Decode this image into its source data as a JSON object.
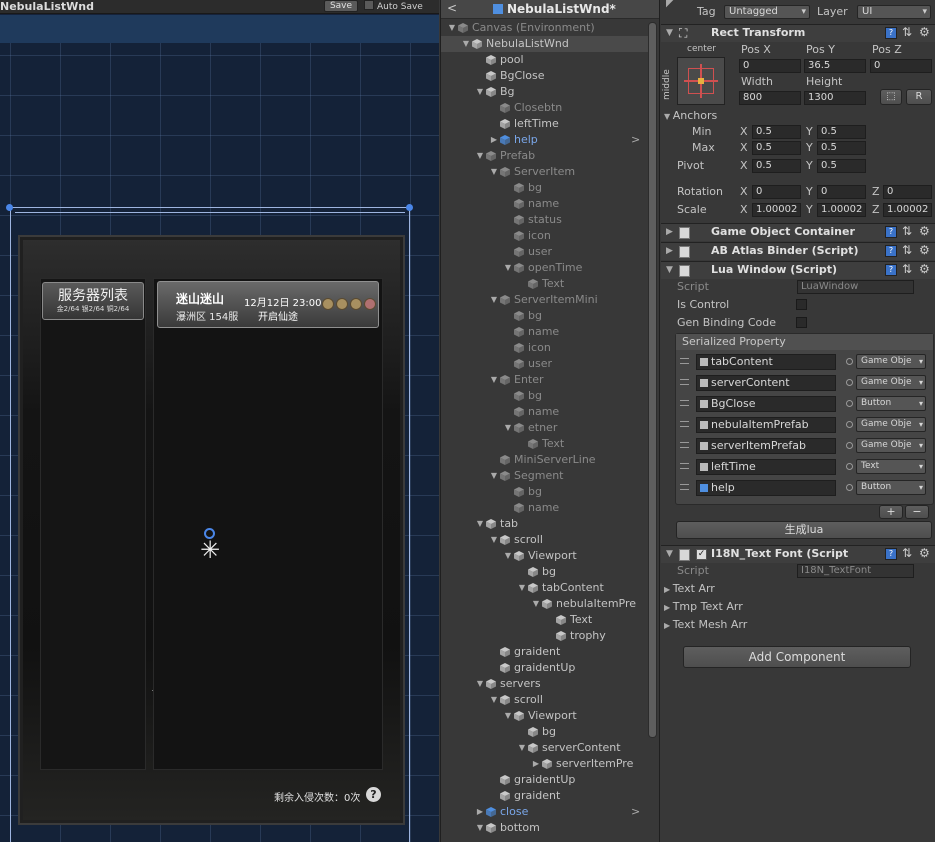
{
  "scene": {
    "title": "NebulaListWnd",
    "save_label": "Save",
    "autosave_label": "Auto Save",
    "tab_title": "服务器列表",
    "tab_sub": "金2/64 银2/64 铜2/64",
    "server_name": "迷山迷山",
    "server_status": "瀑洲区 154服",
    "server_time": "12月12日 23:00",
    "server_open": "开启仙途",
    "remaining": "剩余入侵次数：0次",
    "help_glyph": "?"
  },
  "hierarchy": {
    "back_glyph": "<",
    "title": "NebulaListWnd*",
    "rows": [
      {
        "label": "Canvas (Environment)",
        "depth": 0,
        "arrow": "▼",
        "state": "inactive"
      },
      {
        "label": "NebulaListWnd",
        "depth": 1,
        "arrow": "▼",
        "state": "selected"
      },
      {
        "label": "pool",
        "depth": 2,
        "arrow": "",
        "state": ""
      },
      {
        "label": "BgClose",
        "depth": 2,
        "arrow": "",
        "state": ""
      },
      {
        "label": "Bg",
        "depth": 2,
        "arrow": "▼",
        "state": ""
      },
      {
        "label": "Closebtn",
        "depth": 3,
        "arrow": "",
        "state": "inactive"
      },
      {
        "label": "leftTime",
        "depth": 3,
        "arrow": "",
        "state": ""
      },
      {
        "label": "help",
        "depth": 3,
        "arrow": "▶",
        "state": "blue",
        "chev": ">"
      },
      {
        "label": "Prefab",
        "depth": 2,
        "arrow": "▼",
        "state": "inactive"
      },
      {
        "label": "ServerItem",
        "depth": 3,
        "arrow": "▼",
        "state": "inactive"
      },
      {
        "label": "bg",
        "depth": 4,
        "arrow": "",
        "state": "inactive"
      },
      {
        "label": "name",
        "depth": 4,
        "arrow": "",
        "state": "inactive"
      },
      {
        "label": "status",
        "depth": 4,
        "arrow": "",
        "state": "inactive"
      },
      {
        "label": "icon",
        "depth": 4,
        "arrow": "",
        "state": "inactive"
      },
      {
        "label": "user",
        "depth": 4,
        "arrow": "",
        "state": "inactive"
      },
      {
        "label": "openTime",
        "depth": 4,
        "arrow": "▼",
        "state": "inactive"
      },
      {
        "label": "Text",
        "depth": 5,
        "arrow": "",
        "state": "inactive"
      },
      {
        "label": "ServerItemMini",
        "depth": 3,
        "arrow": "▼",
        "state": "inactive"
      },
      {
        "label": "bg",
        "depth": 4,
        "arrow": "",
        "state": "inactive"
      },
      {
        "label": "name",
        "depth": 4,
        "arrow": "",
        "state": "inactive"
      },
      {
        "label": "icon",
        "depth": 4,
        "arrow": "",
        "state": "inactive"
      },
      {
        "label": "user",
        "depth": 4,
        "arrow": "",
        "state": "inactive"
      },
      {
        "label": "Enter",
        "depth": 3,
        "arrow": "▼",
        "state": "inactive"
      },
      {
        "label": "bg",
        "depth": 4,
        "arrow": "",
        "state": "inactive"
      },
      {
        "label": "name",
        "depth": 4,
        "arrow": "",
        "state": "inactive"
      },
      {
        "label": "etner",
        "depth": 4,
        "arrow": "▼",
        "state": "inactive"
      },
      {
        "label": "Text",
        "depth": 5,
        "arrow": "",
        "state": "inactive"
      },
      {
        "label": "MiniServerLine",
        "depth": 3,
        "arrow": "",
        "state": "inactive"
      },
      {
        "label": "Segment",
        "depth": 3,
        "arrow": "▼",
        "state": "inactive"
      },
      {
        "label": "bg",
        "depth": 4,
        "arrow": "",
        "state": "inactive"
      },
      {
        "label": "name",
        "depth": 4,
        "arrow": "",
        "state": "inactive"
      },
      {
        "label": "tab",
        "depth": 2,
        "arrow": "▼",
        "state": ""
      },
      {
        "label": "scroll",
        "depth": 3,
        "arrow": "▼",
        "state": ""
      },
      {
        "label": "Viewport",
        "depth": 4,
        "arrow": "▼",
        "state": ""
      },
      {
        "label": "bg",
        "depth": 5,
        "arrow": "",
        "state": ""
      },
      {
        "label": "tabContent",
        "depth": 5,
        "arrow": "▼",
        "state": ""
      },
      {
        "label": "nebulaItemPre",
        "depth": 6,
        "arrow": "▼",
        "state": ""
      },
      {
        "label": "Text",
        "depth": 7,
        "arrow": "",
        "state": ""
      },
      {
        "label": "trophy",
        "depth": 7,
        "arrow": "",
        "state": ""
      },
      {
        "label": "graident",
        "depth": 3,
        "arrow": "",
        "state": ""
      },
      {
        "label": "graidentUp",
        "depth": 3,
        "arrow": "",
        "state": ""
      },
      {
        "label": "servers",
        "depth": 2,
        "arrow": "▼",
        "state": ""
      },
      {
        "label": "scroll",
        "depth": 3,
        "arrow": "▼",
        "state": ""
      },
      {
        "label": "Viewport",
        "depth": 4,
        "arrow": "▼",
        "state": ""
      },
      {
        "label": "bg",
        "depth": 5,
        "arrow": "",
        "state": ""
      },
      {
        "label": "serverContent",
        "depth": 5,
        "arrow": "▼",
        "state": ""
      },
      {
        "label": "serverItemPre",
        "depth": 6,
        "arrow": "▶",
        "state": ""
      },
      {
        "label": "graidentUp",
        "depth": 3,
        "arrow": "",
        "state": ""
      },
      {
        "label": "graident",
        "depth": 3,
        "arrow": "",
        "state": ""
      },
      {
        "label": "close",
        "depth": 2,
        "arrow": "▶",
        "state": "blue",
        "chev": ">"
      },
      {
        "label": "bottom",
        "depth": 2,
        "arrow": "▼",
        "state": ""
      }
    ]
  },
  "inspector": {
    "tag_label": "Tag",
    "tag_value": "Untagged",
    "layer_label": "Layer",
    "layer_value": "UI",
    "rect_transform": {
      "title": "Rect Transform",
      "anchor_h": "center",
      "anchor_v": "middle",
      "posx_label": "Pos X",
      "posy_label": "Pos Y",
      "posz_label": "Pos Z",
      "posx": "0",
      "posy": "36.5",
      "posz": "0",
      "width_label": "Width",
      "height_label": "Height",
      "width": "800",
      "height": "1300",
      "r_label": "R",
      "anchors_label": "Anchors",
      "min_label": "Min",
      "max_label": "Max",
      "min_x": "0.5",
      "min_y": "0.5",
      "max_x": "0.5",
      "max_y": "0.5",
      "pivot_label": "Pivot",
      "pivot_x": "0.5",
      "pivot_y": "0.5",
      "rotation_label": "Rotation",
      "rot_x": "0",
      "rot_y": "0",
      "rot_z": "0",
      "scale_label": "Scale",
      "scale_x": "1.00002",
      "scale_y": "1.00002",
      "scale_z": "1.00002",
      "x": "X",
      "y": "Y",
      "z": "Z"
    },
    "components": {
      "goc": "Game Object Container",
      "ab": "AB Atlas Binder (Script)",
      "lua": "Lua Window (Script)",
      "i18n": "I18N_Text Font (Script"
    },
    "lua": {
      "script_label": "Script",
      "script_value": "LuaWindow",
      "is_control": "Is Control",
      "gen_binding": "Gen Binding Code",
      "serialized_header": "Serialized Property",
      "items": [
        {
          "name": "tabContent",
          "type": "Game Obje"
        },
        {
          "name": "serverContent",
          "type": "Game Obje"
        },
        {
          "name": "BgClose",
          "type": "Button"
        },
        {
          "name": "nebulaItemPrefab",
          "type": "Game Obje"
        },
        {
          "name": "serverItemPrefab",
          "type": "Game Obje"
        },
        {
          "name": "leftTime",
          "type": "Text"
        },
        {
          "name": "help",
          "type": "Button"
        }
      ],
      "plus": "+",
      "minus": "−",
      "gen_lua": "生成lua"
    },
    "i18n": {
      "script_label": "Script",
      "script_value": "I18N_TextFont",
      "text_arr": "Text Arr",
      "tmp_text_arr": "Tmp Text Arr",
      "text_mesh_arr": "Text Mesh Arr"
    },
    "add_component": "Add Component"
  },
  "colors": {
    "scene_bg": "#142238",
    "grid": "#4a6a9a",
    "selection": "#4a86e8",
    "panel": "#383838"
  }
}
